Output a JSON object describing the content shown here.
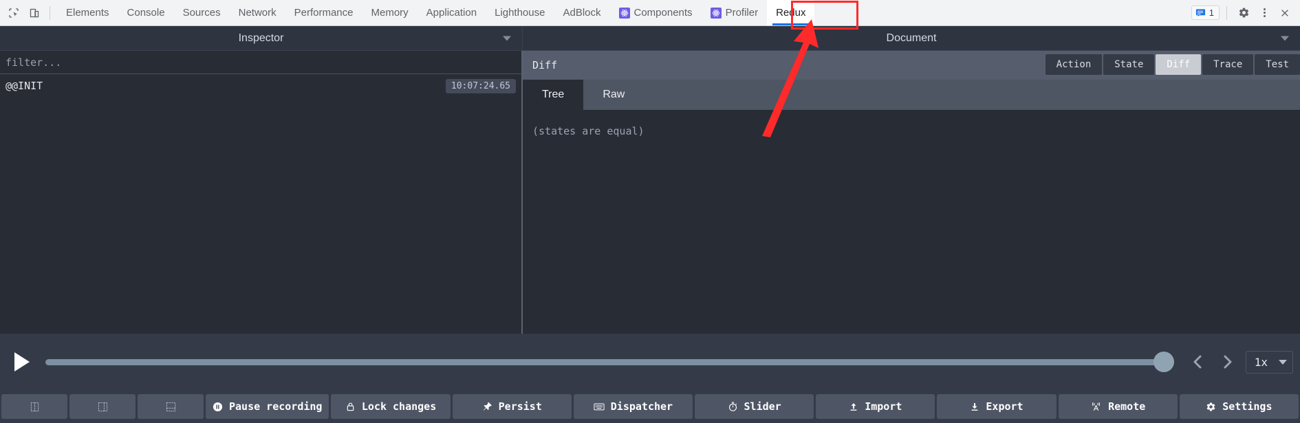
{
  "devtools": {
    "left_icons": [
      {
        "name": "inspect-element-icon",
        "title": "Inspect element"
      },
      {
        "name": "device-toolbar-icon",
        "title": "Toggle device toolbar"
      }
    ],
    "tabs": [
      {
        "label": "Elements",
        "active": false,
        "icon": null
      },
      {
        "label": "Console",
        "active": false,
        "icon": null
      },
      {
        "label": "Sources",
        "active": false,
        "icon": null
      },
      {
        "label": "Network",
        "active": false,
        "icon": null
      },
      {
        "label": "Performance",
        "active": false,
        "icon": null
      },
      {
        "label": "Memory",
        "active": false,
        "icon": null
      },
      {
        "label": "Application",
        "active": false,
        "icon": null
      },
      {
        "label": "Lighthouse",
        "active": false,
        "icon": null
      },
      {
        "label": "AdBlock",
        "active": false,
        "icon": null
      },
      {
        "label": "Components",
        "active": false,
        "icon": "react-icon"
      },
      {
        "label": "Profiler",
        "active": false,
        "icon": "react-icon"
      },
      {
        "label": "Redux",
        "active": true,
        "icon": null
      }
    ],
    "right": {
      "message_count": "1",
      "message_icon": "speech-bubble-icon",
      "settings_icon": "gear-icon",
      "more_icon": "three-dot-menu-icon",
      "close_icon": "close-icon"
    },
    "accent_color": "#1a73e8",
    "toolbar_bg": "#f1f3f4"
  },
  "panels": {
    "left_title": "Inspector",
    "right_title": "Document"
  },
  "inspector": {
    "filter_placeholder": "filter...",
    "filter_value": "",
    "actions": [
      {
        "name": "@@INIT",
        "time": "10:07:24.65"
      }
    ]
  },
  "document": {
    "header_title": "Diff",
    "mode_buttons": [
      {
        "label": "Action",
        "active": false
      },
      {
        "label": "State",
        "active": false
      },
      {
        "label": "Diff",
        "active": true
      },
      {
        "label": "Trace",
        "active": false
      },
      {
        "label": "Test",
        "active": false
      }
    ],
    "subtabs": [
      {
        "label": "Tree",
        "active": true
      },
      {
        "label": "Raw",
        "active": false
      }
    ],
    "content_text": "(states are equal)"
  },
  "playback": {
    "play_icon": "play-icon",
    "slider_position_percent": 100,
    "prev_icon": "chevron-left-icon",
    "next_icon": "chevron-right-icon",
    "speed_label": "1x"
  },
  "bottom_bar": {
    "buttons": [
      {
        "label": "",
        "icon": "layout-vertical-icon",
        "icon_only": true,
        "name": "layout-option-1-button"
      },
      {
        "label": "",
        "icon": "layout-horizontal-icon",
        "icon_only": true,
        "name": "layout-option-2-button"
      },
      {
        "label": "",
        "icon": "layout-stacked-icon",
        "icon_only": true,
        "name": "layout-option-3-button"
      },
      {
        "label": "Pause recording",
        "icon": "pause-icon",
        "icon_only": false,
        "name": "pause-recording-button"
      },
      {
        "label": "Lock changes",
        "icon": "lock-icon",
        "icon_only": false,
        "name": "lock-changes-button"
      },
      {
        "label": "Persist",
        "icon": "pin-icon",
        "icon_only": false,
        "name": "persist-button"
      },
      {
        "label": "Dispatcher",
        "icon": "keyboard-icon",
        "icon_only": false,
        "name": "dispatcher-button"
      },
      {
        "label": "Slider",
        "icon": "stopwatch-icon",
        "icon_only": false,
        "name": "slider-button"
      },
      {
        "label": "Import",
        "icon": "upload-icon",
        "icon_only": false,
        "name": "import-button"
      },
      {
        "label": "Export",
        "icon": "download-icon",
        "icon_only": false,
        "name": "export-button"
      },
      {
        "label": "Remote",
        "icon": "broadcast-icon",
        "icon_only": false,
        "name": "remote-button"
      },
      {
        "label": "Settings",
        "icon": "gear-icon",
        "icon_only": false,
        "name": "settings-button"
      }
    ]
  },
  "annotation": {
    "color": "#ff2a2a",
    "highlight_target": "Redux",
    "shape": "rectangle-and-arrow"
  }
}
